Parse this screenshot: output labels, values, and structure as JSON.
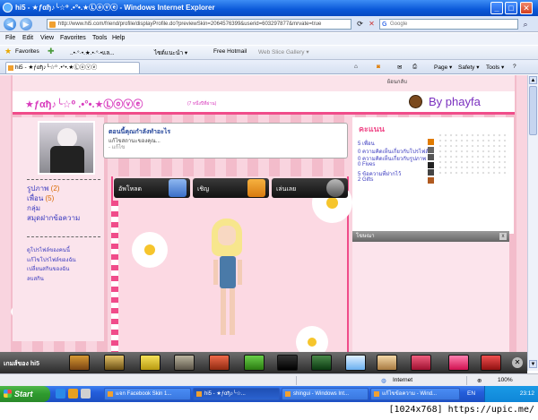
{
  "window": {
    "title": "hi5 - ★ƒαђ♪╰☆⁰ .•°•.★Ⓛⓞⓥⓔ - Windows Internet Explorer",
    "min": "_",
    "max": "□",
    "close": "✕"
  },
  "address": {
    "url": "http://www.hi5.com/friend/profile/displayProfile.do?previewSkin=2064576399&userid=603297877&mrvate=true",
    "search_placeholder": "Google",
    "search_brand": "G"
  },
  "menu": [
    "File",
    "Edit",
    "View",
    "Favorites",
    "Tools",
    "Help"
  ],
  "favorites": {
    "label": "Favorites",
    "items": [
      "..•·°·•.★.•·°·•แล...",
      "ไซต์แนะนำ ▾",
      "Free Hotmail",
      "Web Slice Gallery ▾"
    ]
  },
  "tab": {
    "label": "hi5 - ★ƒαђ♪╰☆⁰ .•°•.★Ⓛⓞⓥⓔ"
  },
  "commandbar": [
    "Page ▾",
    "Safety ▾",
    "Tools ▾",
    "?"
  ],
  "profile": {
    "name": "★ƒαђ♪╰☆⁰ .•°•.★Ⓛⓞⓥⓔ",
    "sub": "(7 หนึ่งปีที่ผ่าน)",
    "brand": "By  phayfa",
    "top_link": "ย้อนกลับ"
  },
  "status": {
    "title": "ตอนนี้คุณกำลังทำอะไร",
    "line1": "แก้ไขสถานะของคุณ...",
    "line2": "- แก้ไข"
  },
  "nav_links": [
    {
      "label": "รูปภาพ",
      "count": "(2)"
    },
    {
      "label": "เพื่อน",
      "count": "(5)"
    },
    {
      "label": "กลุ่ม",
      "count": ""
    },
    {
      "label": "สมุดฝากข้อความ",
      "count": ""
    }
  ],
  "small_links": [
    "ดูโปรไฟล์ของคนนี้",
    "แก้ไขโปรไฟล์ของฉัน",
    "เปลี่ยนสกินของฉัน",
    "ลบสกิน"
  ],
  "actions": [
    {
      "label": "อัพโหลด"
    },
    {
      "label": "เชิญ"
    },
    {
      "label": "เล่นเลย"
    }
  ],
  "scores": {
    "header": "คะแนน",
    "rows": [
      "5 เพื่อน",
      "0 ความคิดเห็นเกี่ยวกับโปรไฟล์",
      "0 ความคิดเห็นเกี่ยวกับรูปภาพ",
      "0 Fives",
      "5 ข้อความที่ฝากไว้",
      "2 Gifts"
    ]
  },
  "friends_box": {
    "header": "โฆษณา",
    "close": "x"
  },
  "hi5bar": {
    "label": "เกมส์ของ hi5",
    "close": "✕"
  },
  "statusbar": {
    "zone": "Internet",
    "zoom": "100%"
  },
  "taskbar": {
    "start": "Start",
    "tasks": [
      "แจก Facebook Skin 1...",
      "hi5 - ★ƒαђ♪╰☆...",
      "shingui - Windows Int...",
      "แก้ไขข้อความ - Wind..."
    ],
    "lang": "EN",
    "clock": "23:12"
  },
  "caption": "[1024x768] https://upic.me/",
  "colors": {
    "accent_pink": "#f04c8a",
    "link_blue": "#3a3abf",
    "brand_purple": "#7a2fbf",
    "title_blue": "#0a58d8"
  }
}
